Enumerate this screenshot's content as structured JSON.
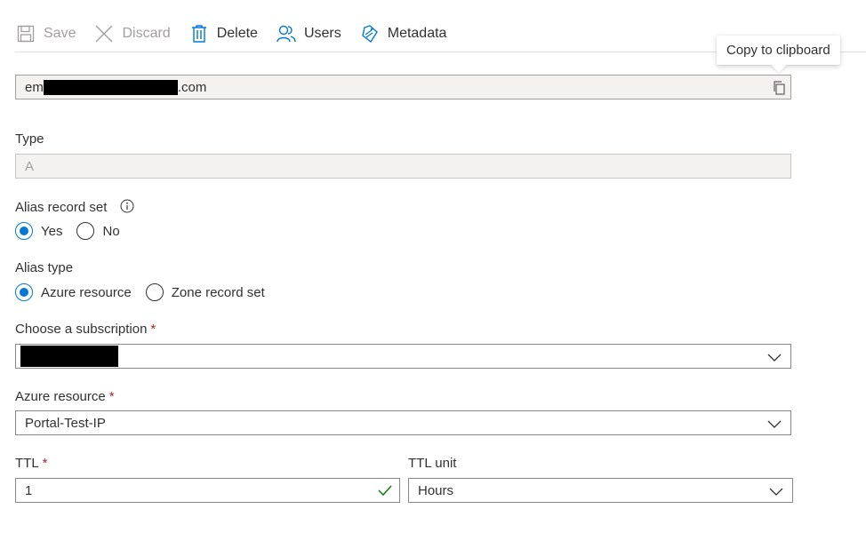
{
  "toolbar": {
    "save": "Save",
    "discard": "Discard",
    "delete": "Delete",
    "users": "Users",
    "metadata": "Metadata"
  },
  "tooltip": {
    "text": "Copy to clipboard"
  },
  "name_field": {
    "prefix": "em",
    "suffix": ".com"
  },
  "type": {
    "label": "Type",
    "value": "A"
  },
  "alias_record_set": {
    "label": "Alias record set",
    "options": [
      "Yes",
      "No"
    ],
    "selected": "Yes"
  },
  "alias_type": {
    "label": "Alias type",
    "options": [
      "Azure resource",
      "Zone record set"
    ],
    "selected": "Azure resource"
  },
  "subscription": {
    "label": "Choose a subscription",
    "required_mark": "*"
  },
  "azure_resource": {
    "label": "Azure resource",
    "required_mark": "*",
    "value": "Portal-Test-IP"
  },
  "ttl": {
    "label": "TTL",
    "required_mark": "*",
    "value": "1"
  },
  "ttl_unit": {
    "label": "TTL unit",
    "value": "Hours"
  },
  "colors": {
    "accent": "#0078d4",
    "required": "#a4262c",
    "valid": "#107c10"
  }
}
